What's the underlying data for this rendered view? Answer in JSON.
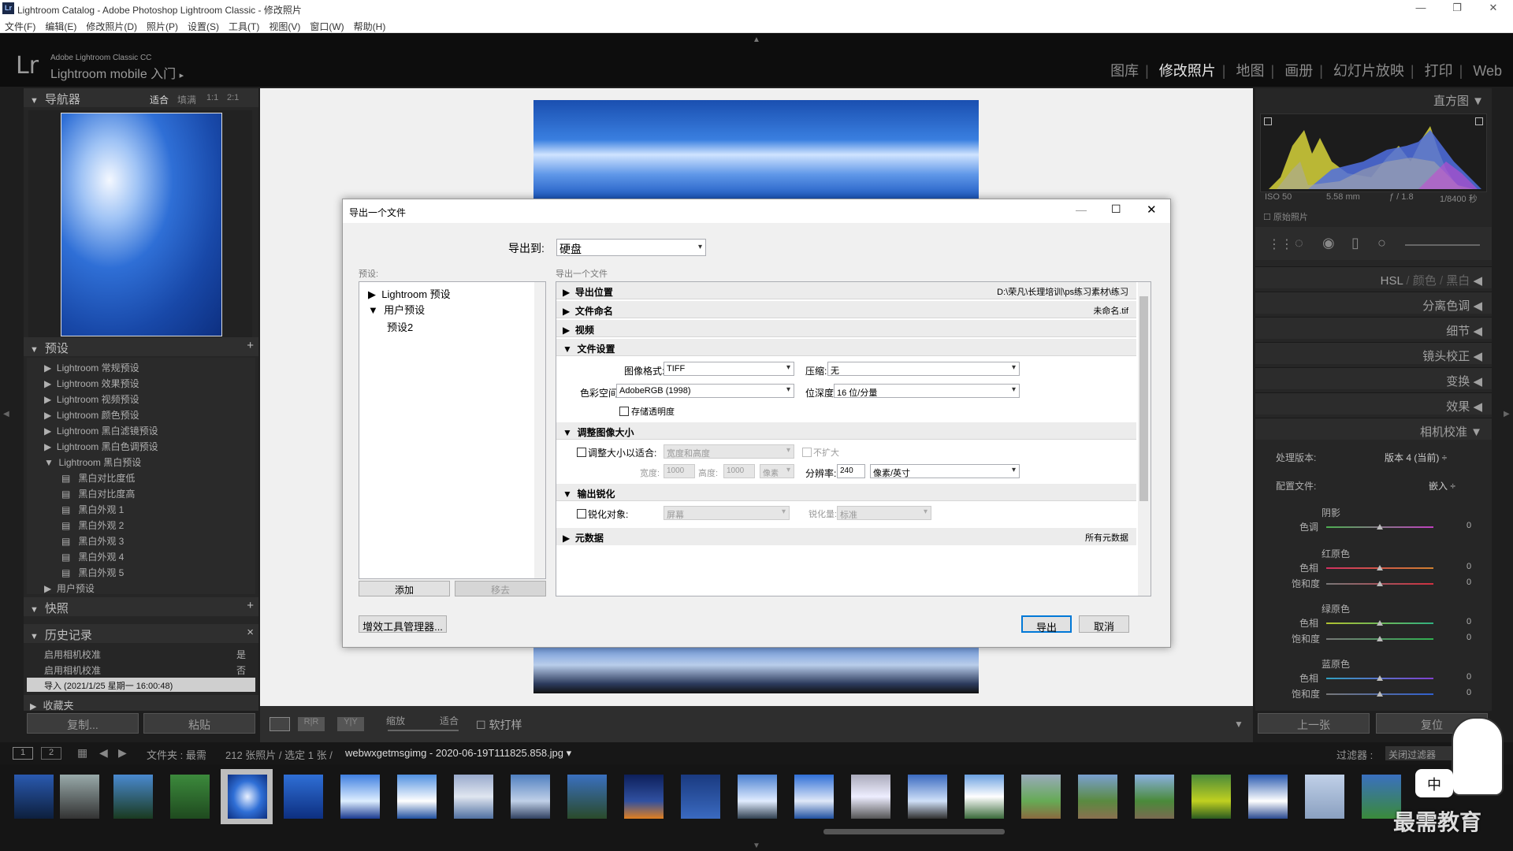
{
  "window": {
    "title": "Lightroom Catalog - Adobe Photoshop Lightroom Classic - 修改照片",
    "app_icon": "Lr"
  },
  "menu": [
    "文件(F)",
    "编辑(E)",
    "修改照片(D)",
    "照片(P)",
    "设置(S)",
    "工具(T)",
    "视图(V)",
    "窗口(W)",
    "帮助(H)"
  ],
  "identity": {
    "logo": "Lr",
    "product": "Adobe Lightroom Classic CC",
    "mobile": "Lightroom mobile 入门",
    "arrow": "▸"
  },
  "modules": [
    {
      "label": "图库"
    },
    {
      "label": "修改照片",
      "active": true
    },
    {
      "label": "地图"
    },
    {
      "label": "画册"
    },
    {
      "label": "幻灯片放映"
    },
    {
      "label": "打印"
    },
    {
      "label": "Web"
    }
  ],
  "navigator": {
    "title": "导航器",
    "zoom": [
      "适合",
      "填满",
      "1:1",
      "2:1"
    ]
  },
  "presets": {
    "title": "预设",
    "items": [
      "Lightroom 常规预设",
      "Lightroom 效果预设",
      "Lightroom 视频预设",
      "Lightroom 颜色预设",
      "Lightroom 黑白滤镜预设",
      "Lightroom 黑白色调预设",
      "Lightroom 黑白预设"
    ],
    "sub": [
      "黑白对比度低",
      "黑白对比度高",
      "黑白外观 1",
      "黑白外观 2",
      "黑白外观 3",
      "黑白外观 4",
      "黑白外观 5"
    ],
    "user": "用户预设"
  },
  "snapshots": {
    "title": "快照"
  },
  "history": {
    "title": "历史记录",
    "rows": [
      {
        "label": "启用相机校准",
        "value": "是"
      },
      {
        "label": "启用相机校准",
        "value": "否"
      },
      {
        "label": "导入 (2021/1/25 星期一 16:00:48)",
        "value": ""
      }
    ]
  },
  "collections": {
    "title": "收藏夹"
  },
  "left_buttons": {
    "copy": "复制...",
    "paste": "粘贴"
  },
  "right": {
    "histogram_title": "直方图",
    "iso": "ISO 50",
    "focal": "5.58 mm",
    "aperture": "ƒ / 1.8",
    "shutter": "1/8400 秒",
    "original": "原始照片",
    "hsl": "HSL",
    "color": "颜色",
    "bw": "黑白",
    "split": "分离色调",
    "detail": "细节",
    "lens": "镜头校正",
    "transform": "变换",
    "effects": "效果",
    "calibration": "相机校准",
    "process_label": "处理版本:",
    "process_value": "版本 4 (当前) ÷",
    "profile_label": "配置文件:",
    "profile_value": "嵌入 ÷",
    "shadow": "阴影",
    "tint": "色调",
    "red": "红原色",
    "green": "绿原色",
    "blue": "蓝原色",
    "hue": "色相",
    "sat": "饱和度",
    "zero": "0",
    "prev": "上一张",
    "reset": "复位"
  },
  "toolbar": {
    "zoom_label": "缩放",
    "fit": "适合",
    "soft_proof": "软打样"
  },
  "filmbar": {
    "pages": [
      "1",
      "2"
    ],
    "path": "文件夹 : 最需",
    "count": "212 张照片 / 选定 1 张 /",
    "filename": "webwxgetmsgimg - 2020-06-19T111825.858.jpg",
    "filter_label": "过滤器 :",
    "filter_value": "关闭过滤器"
  },
  "watermark": {
    "text": "最需教育",
    "badge": "中"
  },
  "dialog": {
    "title": "导出一个文件",
    "export_to_label": "导出到:",
    "export_to_value": "硬盘",
    "presets_label": "预设:",
    "list_label": "导出一个文件",
    "tree": [
      "Lightroom 预设",
      "用户预设",
      "预设2"
    ],
    "add": "添加",
    "remove": "移去",
    "sections": {
      "location": "导出位置",
      "location_value": "D:\\荣凡\\长理培训\\ps练习素材\\练习",
      "naming": "文件命名",
      "naming_value": "未命名.tif",
      "video": "视频",
      "file_settings": "文件设置",
      "resize": "调整图像大小",
      "sharpen": "输出锐化",
      "metadata": "元数据",
      "metadata_value": "所有元数据"
    },
    "format_label": "图像格式:",
    "format_value": "TIFF",
    "compress_label": "压缩:",
    "compress_value": "无",
    "colorspace_label": "色彩空间:",
    "colorspace_value": "AdobeRGB (1998)",
    "bitdepth_label": "位深度:",
    "bitdepth_value": "16 位/分量",
    "transparency": "存储透明度",
    "resize_fit": "调整大小以适合:",
    "resize_mode": "宽度和高度",
    "no_enlarge": "不扩大",
    "width_label": "宽度:",
    "width_value": "1000",
    "height_label": "高度:",
    "height_value": "1000",
    "unit": "像素",
    "resolution_label": "分辨率:",
    "resolution_value": "240",
    "resolution_unit": "像素/英寸",
    "sharpen_for": "锐化对象:",
    "sharpen_target": "屏幕",
    "sharpen_amount_label": "锐化量:",
    "sharpen_amount": "标准",
    "plugin_manager": "增效工具管理器...",
    "export": "导出",
    "cancel": "取消"
  }
}
